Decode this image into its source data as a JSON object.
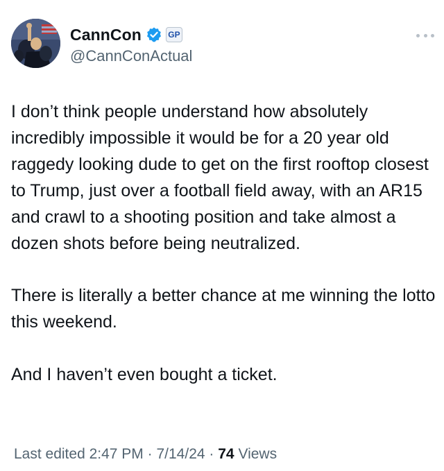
{
  "author": {
    "display_name": "CannCon",
    "handle": "@CannConActual",
    "badge_text": "GP",
    "verified_color": "#1d9bf0",
    "avatar_icon": "profile-photo"
  },
  "more_icon": "more-horizontal-icon",
  "tweet": {
    "paragraphs": [
      "I don’t think people understand how absolutely incredibly impossible it would be for a 20 year old raggedy looking dude to get on the first rooftop closest to Trump, just over a football field away, with an AR15 and crawl to a shooting position and take almost a dozen shots before being neutralized.",
      "There is literally a better chance at me winning the lotto this weekend.",
      "And I haven’t even bought a ticket."
    ]
  },
  "meta": {
    "edited_label": "Last edited",
    "time": "2:47 PM",
    "date": "7/14/24",
    "views_count": "74",
    "views_label": "Views"
  },
  "colors": {
    "text_primary": "#0f1419",
    "text_secondary": "#536471",
    "verified_blue": "#1d9bf0"
  }
}
